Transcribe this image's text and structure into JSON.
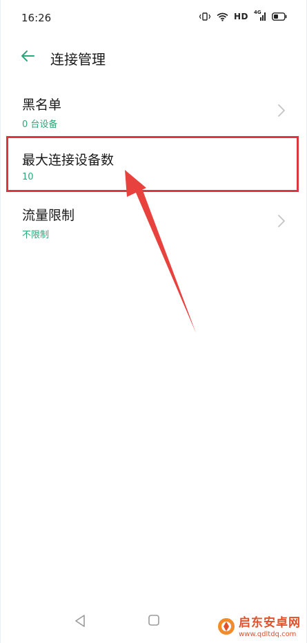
{
  "status_bar": {
    "time": "16:26",
    "hd": "HD",
    "network": "4G"
  },
  "header": {
    "title": "连接管理"
  },
  "list": [
    {
      "title": "黑名单",
      "subtitle": "0 台设备",
      "has_chevron": true
    },
    {
      "title": "最大连接设备数",
      "subtitle": "10",
      "has_chevron": false
    },
    {
      "title": "流量限制",
      "subtitle": "不限制",
      "has_chevron": true
    }
  ],
  "watermark": {
    "title": "启东安卓网",
    "url": "www.qdltdq.com"
  },
  "colors": {
    "accent": "#2aa878",
    "highlight": "#d9363e",
    "watermark": "#e0502a"
  }
}
